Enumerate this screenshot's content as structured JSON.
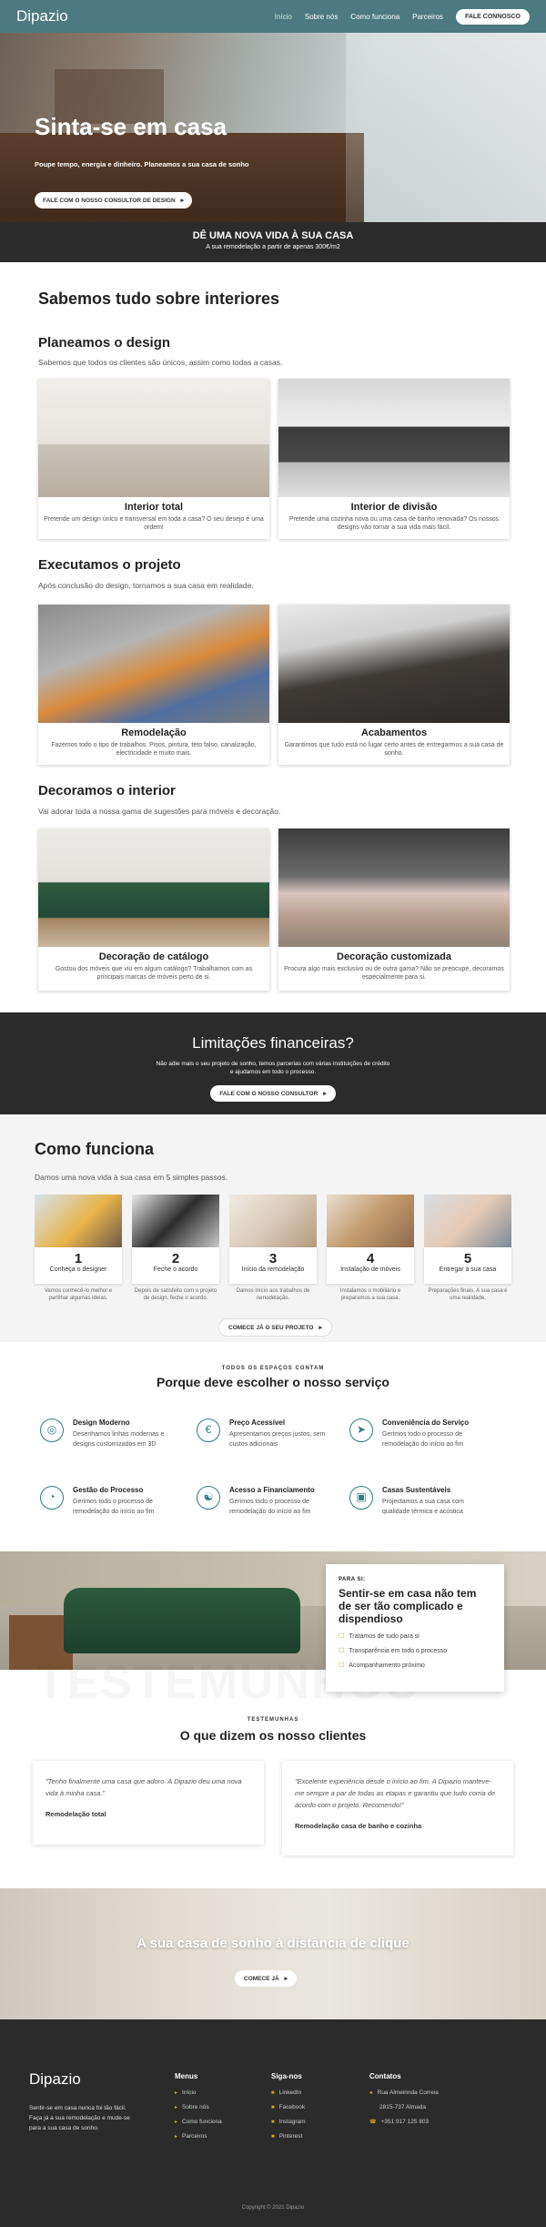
{
  "header": {
    "logo": "Dipazio",
    "nav": [
      "Início",
      "Sobre nós",
      "Como funciona",
      "Parceiros"
    ],
    "cta": "FALE CONNOSCO"
  },
  "hero": {
    "title": "Sinta-se em casa",
    "subtitle": "Poupe tempo, energia e dinheiro. Planeamos a sua casa de sonho",
    "button": "FALE COM O NOSSO CONSULTOR DE DESIGN"
  },
  "band": {
    "title": "DÊ UMA NOVA VIDA À SUA CASA",
    "text": "A sua remodelação a partir de apenas 300€/m2"
  },
  "interiores": {
    "title": "Sabemos tudo sobre interiores",
    "design": {
      "title": "Planeamos o design",
      "lead": "Sabemos que todos os clientes são únicos, assim como todas a casas.",
      "cards": [
        {
          "title": "Interior total",
          "desc": "Pretende um design único e transversal em toda a casa? O seu desejo é uma ordem!"
        },
        {
          "title": "Interior de divisão",
          "desc": "Pretende uma cozinha nova ou uma casa de banho renovada? Os nossos designs vão tornar a sua vida mais fácil."
        }
      ]
    },
    "projeto": {
      "title": "Executamos o projeto",
      "lead": "Após conclusão do design, tornamos a sua casa em realidade.",
      "cards": [
        {
          "title": "Remodelação",
          "desc": "Fazemos todo o tipo de trabalhos. Pisos, pintura, teto falso, canalização, electricidade e muito mais."
        },
        {
          "title": "Acabamentos",
          "desc": "Garantimos que tudo está no lugar certo antes de entregarmos a sua casa de sonho."
        }
      ]
    },
    "decoramos": {
      "title": "Decoramos o interior",
      "lead": "Vai adorar toda a nossa gama de sugestões para móveis e decoração.",
      "cards": [
        {
          "title": "Decoração de catálogo",
          "desc": "Gostou dos móveis que viu em algum catálogo? Trabalhamos com as principais marcas de móveis perto de si."
        },
        {
          "title": "Decoração customizada",
          "desc": "Procura algo mais exclusivo ou de outra gama? Não se preocupe, decoramos especialmente para si."
        }
      ]
    }
  },
  "limitacoes": {
    "title": "Limitações financeiras?",
    "desc1": "Não adie mais o seu projeto de sonho, temos parcerias com várias instituições de crédito",
    "desc2": "e ajudamos em todo o processo.",
    "button": "FALE COM O NOSSO CONSULTOR"
  },
  "como": {
    "title": "Como funciona",
    "lead": "Damos uma nova vida à sua casa em 5 simples passos.",
    "steps": [
      {
        "n": "1",
        "title": "Conheça o designer",
        "desc": "Vamos conhecê-lo melhor e partilhar algumas ideias."
      },
      {
        "n": "2",
        "title": "Feche o acordo",
        "desc": "Depois de satisfeito com o projeto de design, feche o acordo."
      },
      {
        "n": "3",
        "title": "Início da remodelação",
        "desc": "Damos início aos trabalhos de remodelação."
      },
      {
        "n": "4",
        "title": "Instalação de móveis",
        "desc": "Instalamos o mobiliário e preparamos a sua casa."
      },
      {
        "n": "5",
        "title": "Entregar a sua casa",
        "desc": "Preparações finais. A sua casa é uma realidade."
      }
    ],
    "button": "COMECE JÁ O SEU PROJETO"
  },
  "porque": {
    "kicker": "TODOS OS ESPAÇOS CONTAM",
    "title": "Porque deve escolher o nosso serviço",
    "features": [
      {
        "icon": "compass-icon",
        "title": "Design Moderno",
        "desc": "Desenhamos linhas modernas e designs customizados em 3D"
      },
      {
        "icon": "euro-icon",
        "title": "Preço Acessível",
        "desc": "Apresentamos preços justos, sem custos adicionais"
      },
      {
        "icon": "paper-plane-icon",
        "title": "Conveniência do Serviço",
        "desc": "Gerimos todo o processo de remodelação do início ao fim"
      },
      {
        "icon": "gauge-icon",
        "title": "Gestão do Processo",
        "desc": "Gerimos todo o processo de remodelação do início ao fim"
      },
      {
        "icon": "handshake-icon",
        "title": "Acesso a Financiamento",
        "desc": "Gerimos todo o processo de remodelação do início ao fim"
      },
      {
        "icon": "buildings-icon",
        "title": "Casas Sustentáveis",
        "desc": "Projectamos a sua casa com qualidade térmica e acústica"
      }
    ]
  },
  "parasi": {
    "kicker": "PARA SI:",
    "title": "Sentir-se em casa não tem de ser tão complicado e dispendioso",
    "items": [
      "Tratamos de tudo para si",
      "Transparência em todo o processo",
      "Acompanhamento próximo"
    ]
  },
  "testemunhos": {
    "watermark": "TESTEMUNHOS",
    "kicker": "TESTEMUNHAS",
    "title": "O que dizem os nosso clientes",
    "items": [
      {
        "quote": "\"Tenho finalmente uma casa que adoro. A Dipazio deu uma nova vida à minha casa.\"",
        "author": "Remodelação total"
      },
      {
        "quote": "\"Excelente experiência desde o início ao fim. A Dipazio manteve-me sempre a par de todas as etapas e garantiu que tudo corria de acordo com o projeto. Recomendo!\"",
        "author": "Remodelação casa de banho e cozinha"
      }
    ]
  },
  "ctab": {
    "title": "A sua casa de sonho à distância de clique",
    "button": "COMECE JÁ"
  },
  "footer": {
    "logo": "Dipazio",
    "desc": "Sentir-se em casa nunca foi tão fácil. Faça já a sua remodelação e mude-se para a sua casa de sonho.",
    "menus_title": "Menus",
    "menus": [
      "Início",
      "Sobre nós",
      "Como funciona",
      "Parceiros"
    ],
    "siga_title": "Siga-nos",
    "siga": [
      "LinkedIn",
      "Facebook",
      "Instagram",
      "Pinterest"
    ],
    "contact_title": "Contatos",
    "address1": "Rua Almeirinda Correia",
    "address2": "2815-737 Almada",
    "phone": "+351 917 125 803",
    "copyright": "Copyright © 2021 Dipazio"
  }
}
